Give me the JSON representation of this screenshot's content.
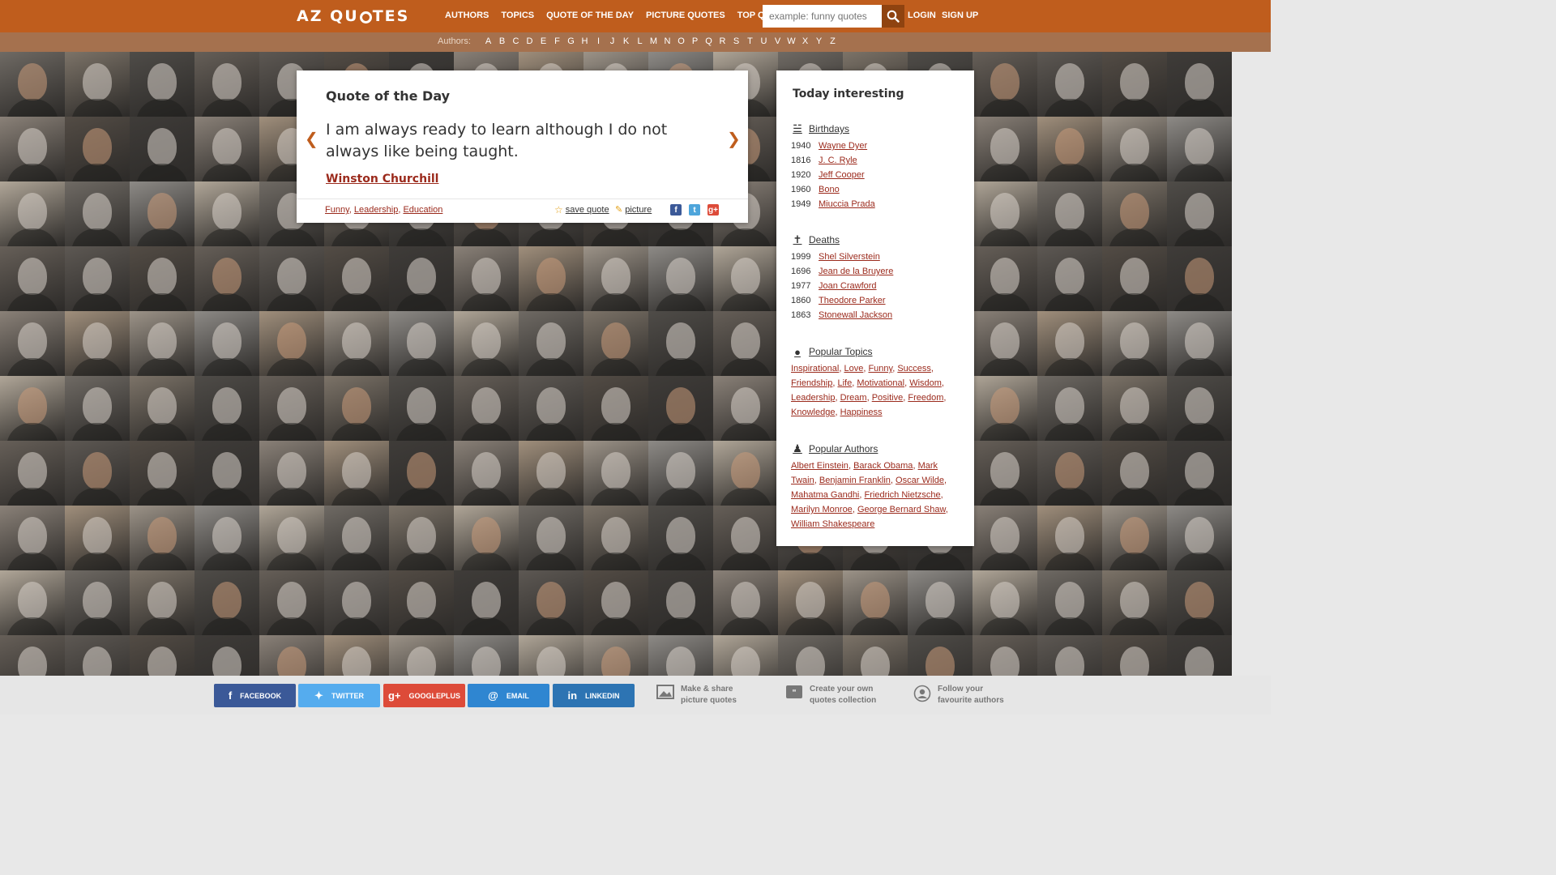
{
  "header": {
    "logo_left": "AZ QU",
    "logo_right": "TES",
    "nav": [
      "AUTHORS",
      "TOPICS",
      "QUOTE OF THE DAY",
      "PICTURE QUOTES",
      "TOP QUOTES"
    ],
    "search_placeholder": "example: funny quotes",
    "login": "LOGIN",
    "signup": "SIGN UP"
  },
  "alpha_bar": {
    "label": "Authors:",
    "letters": [
      "A",
      "B",
      "C",
      "D",
      "E",
      "F",
      "G",
      "H",
      "I",
      "J",
      "K",
      "L",
      "M",
      "N",
      "O",
      "P",
      "Q",
      "R",
      "S",
      "T",
      "U",
      "V",
      "W",
      "X",
      "Y",
      "Z"
    ]
  },
  "quote_card": {
    "title": "Quote of the Day",
    "text": "I am always ready to learn although I do not always like being taught.",
    "author": "Winston Churchill",
    "tags": [
      "Funny",
      "Leadership",
      "Education"
    ],
    "save_label": "save quote",
    "picture_label": "picture",
    "share": [
      {
        "icon": "f",
        "color": "#3b5998"
      },
      {
        "icon": "t",
        "color": "#4ea5db"
      },
      {
        "icon": "g+",
        "color": "#dd4b39"
      }
    ]
  },
  "side": {
    "title": "Today interesting",
    "birthdays_label": "Birthdays",
    "birthdays": [
      {
        "year": "1940",
        "name": "Wayne Dyer"
      },
      {
        "year": "1816",
        "name": "J. C. Ryle"
      },
      {
        "year": "1920",
        "name": "Jeff Cooper"
      },
      {
        "year": "1960",
        "name": "Bono"
      },
      {
        "year": "1949",
        "name": "Miuccia Prada"
      }
    ],
    "deaths_label": "Deaths",
    "deaths": [
      {
        "year": "1999",
        "name": "Shel Silverstein"
      },
      {
        "year": "1696",
        "name": "Jean de la Bruyere"
      },
      {
        "year": "1977",
        "name": "Joan Crawford"
      },
      {
        "year": "1860",
        "name": "Theodore Parker"
      },
      {
        "year": "1863",
        "name": "Stonewall Jackson"
      }
    ],
    "topics_label": "Popular Topics",
    "topics": [
      "Inspirational",
      "Love",
      "Funny",
      "Success",
      "Friendship",
      "Life",
      "Motivational",
      "Wisdom",
      "Leadership",
      "Dream",
      "Positive",
      "Freedom",
      "Knowledge",
      "Happiness"
    ],
    "authors_label": "Popular Authors",
    "authors": [
      "Albert Einstein",
      "Barack Obama",
      "Mark Twain",
      "Benjamin Franklin",
      "Oscar Wilde",
      "Mahatma Gandhi",
      "Friedrich Nietzsche",
      "Marilyn Monroe",
      "George Bernard Shaw",
      "William Shakespeare"
    ]
  },
  "footer": {
    "buttons": [
      {
        "label": "FACEBOOK",
        "icon": "facebook-icon",
        "color": "#3b5998"
      },
      {
        "label": "TWITTER",
        "icon": "twitter-icon",
        "color": "#55acee"
      },
      {
        "label": "GOOGLEPLUS",
        "icon": "googleplus-icon",
        "color": "#dd4b39"
      },
      {
        "label": "EMAIL",
        "icon": "email-icon",
        "color": "#2f86d1"
      },
      {
        "label": "LINKEDIN",
        "icon": "linkedin-icon",
        "color": "#2d74b3"
      }
    ],
    "features": [
      {
        "line1": "Make & share",
        "line2": "picture quotes",
        "icon": "picture-icon"
      },
      {
        "line1": "Create your own",
        "line2": "quotes collection",
        "icon": "collection-icon"
      },
      {
        "line1": "Follow your",
        "line2": "favourite authors",
        "icon": "follow-icon"
      }
    ]
  },
  "colors": {
    "accent": "#bf5d1d",
    "link": "#9b2a1c",
    "alpha_bar": "#a5714e"
  }
}
